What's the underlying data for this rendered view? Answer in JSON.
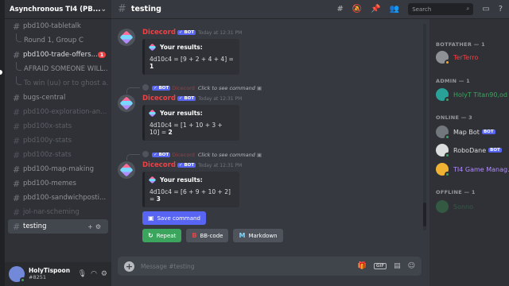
{
  "server": {
    "name": "Asynchronous TI4 (PB..."
  },
  "channels": [
    {
      "label": "pbd100-tabletalk",
      "kind": "channel",
      "state": "normal"
    },
    {
      "label": "Round 1, Group C",
      "kind": "thread",
      "state": "normal"
    },
    {
      "label": "pbd100-trade-offers...",
      "kind": "channel",
      "state": "bright",
      "badge": "1"
    },
    {
      "label": "AFRAID SOMEONE WILL...",
      "kind": "thread",
      "state": "normal"
    },
    {
      "label": "To win (uu) or to ghost a...",
      "kind": "thread",
      "state": "muted"
    },
    {
      "label": "bugs-central",
      "kind": "channel",
      "state": "normal"
    },
    {
      "label": "pbd100-exploration-an...",
      "kind": "channel",
      "state": "muted"
    },
    {
      "label": "pbd100x-stats",
      "kind": "channel",
      "state": "muted"
    },
    {
      "label": "pbd100y-stats",
      "kind": "channel",
      "state": "muted"
    },
    {
      "label": "pbd100z-stats",
      "kind": "channel",
      "state": "muted"
    },
    {
      "label": "pbd100-map-making",
      "kind": "channel",
      "state": "normal"
    },
    {
      "label": "pbd100-memes",
      "kind": "channel",
      "state": "normal"
    },
    {
      "label": "pbd100-sandwichposti...",
      "kind": "channel",
      "state": "normal"
    },
    {
      "label": "jol-nar-scheming",
      "kind": "channel",
      "state": "muted"
    },
    {
      "label": "testing",
      "kind": "channel",
      "state": "active"
    }
  ],
  "user": {
    "name": "HolyTispoon",
    "tag": "#8251"
  },
  "header": {
    "channel": "testing",
    "search_placeholder": "Search"
  },
  "messages": [
    {
      "author": "Dicecord",
      "bot": "✓ BOT",
      "time": "Today at 12:31 PM",
      "reply": null,
      "embed_title": "Your results:",
      "formula": "4d10c4 = [9 + 2 + 4 + 4] = ",
      "total": "1"
    },
    {
      "author": "Dicecord",
      "bot": "✓ BOT",
      "time": "Today at 12:31 PM",
      "reply": {
        "bot": "✓ BOT",
        "name": "Dicecord",
        "text": "Click to see command"
      },
      "embed_title": "Your results:",
      "formula": "4d10c4 = [1 + 10 + 3 + 10] = ",
      "total": "2"
    },
    {
      "author": "Dicecord",
      "bot": "✓ BOT",
      "time": "Today at 12:31 PM",
      "reply": {
        "bot": "✓ BOT",
        "name": "Dicecord",
        "text": "Click to see command"
      },
      "embed_title": "Your results:",
      "formula": "4d10c4 = [6 + 9 + 10 + 2] = ",
      "total": "3"
    }
  ],
  "buttons": {
    "save": "Save command",
    "repeat": "Repeat",
    "bbcode": "BB-code",
    "markdown": "Markdown"
  },
  "composer": {
    "placeholder": "Message #testing"
  },
  "members": {
    "sections": [
      {
        "title": "BOTFATHER — 1"
      },
      {
        "title": "ADMIN — 1"
      },
      {
        "title": "ONLINE — 3"
      },
      {
        "title": "OFFLINE — 1"
      }
    ],
    "list": [
      {
        "name": "TerTerro",
        "color": "#ed4245"
      },
      {
        "name": "HolyT Titan90,od",
        "color": "#3ba55d"
      },
      {
        "name": "Map Bot",
        "color": "#dcddde",
        "bot": "BOT"
      },
      {
        "name": "RoboDane",
        "color": "#dcddde",
        "bot": "BOT"
      },
      {
        "name": "TI4 Game Manag...",
        "color": "#b18cff"
      },
      {
        "name": "Sonno",
        "color": "#3ba55d"
      }
    ]
  },
  "colors": {
    "accent": "#5865f2",
    "danger": "#ed4245",
    "success": "#3ba55d"
  }
}
